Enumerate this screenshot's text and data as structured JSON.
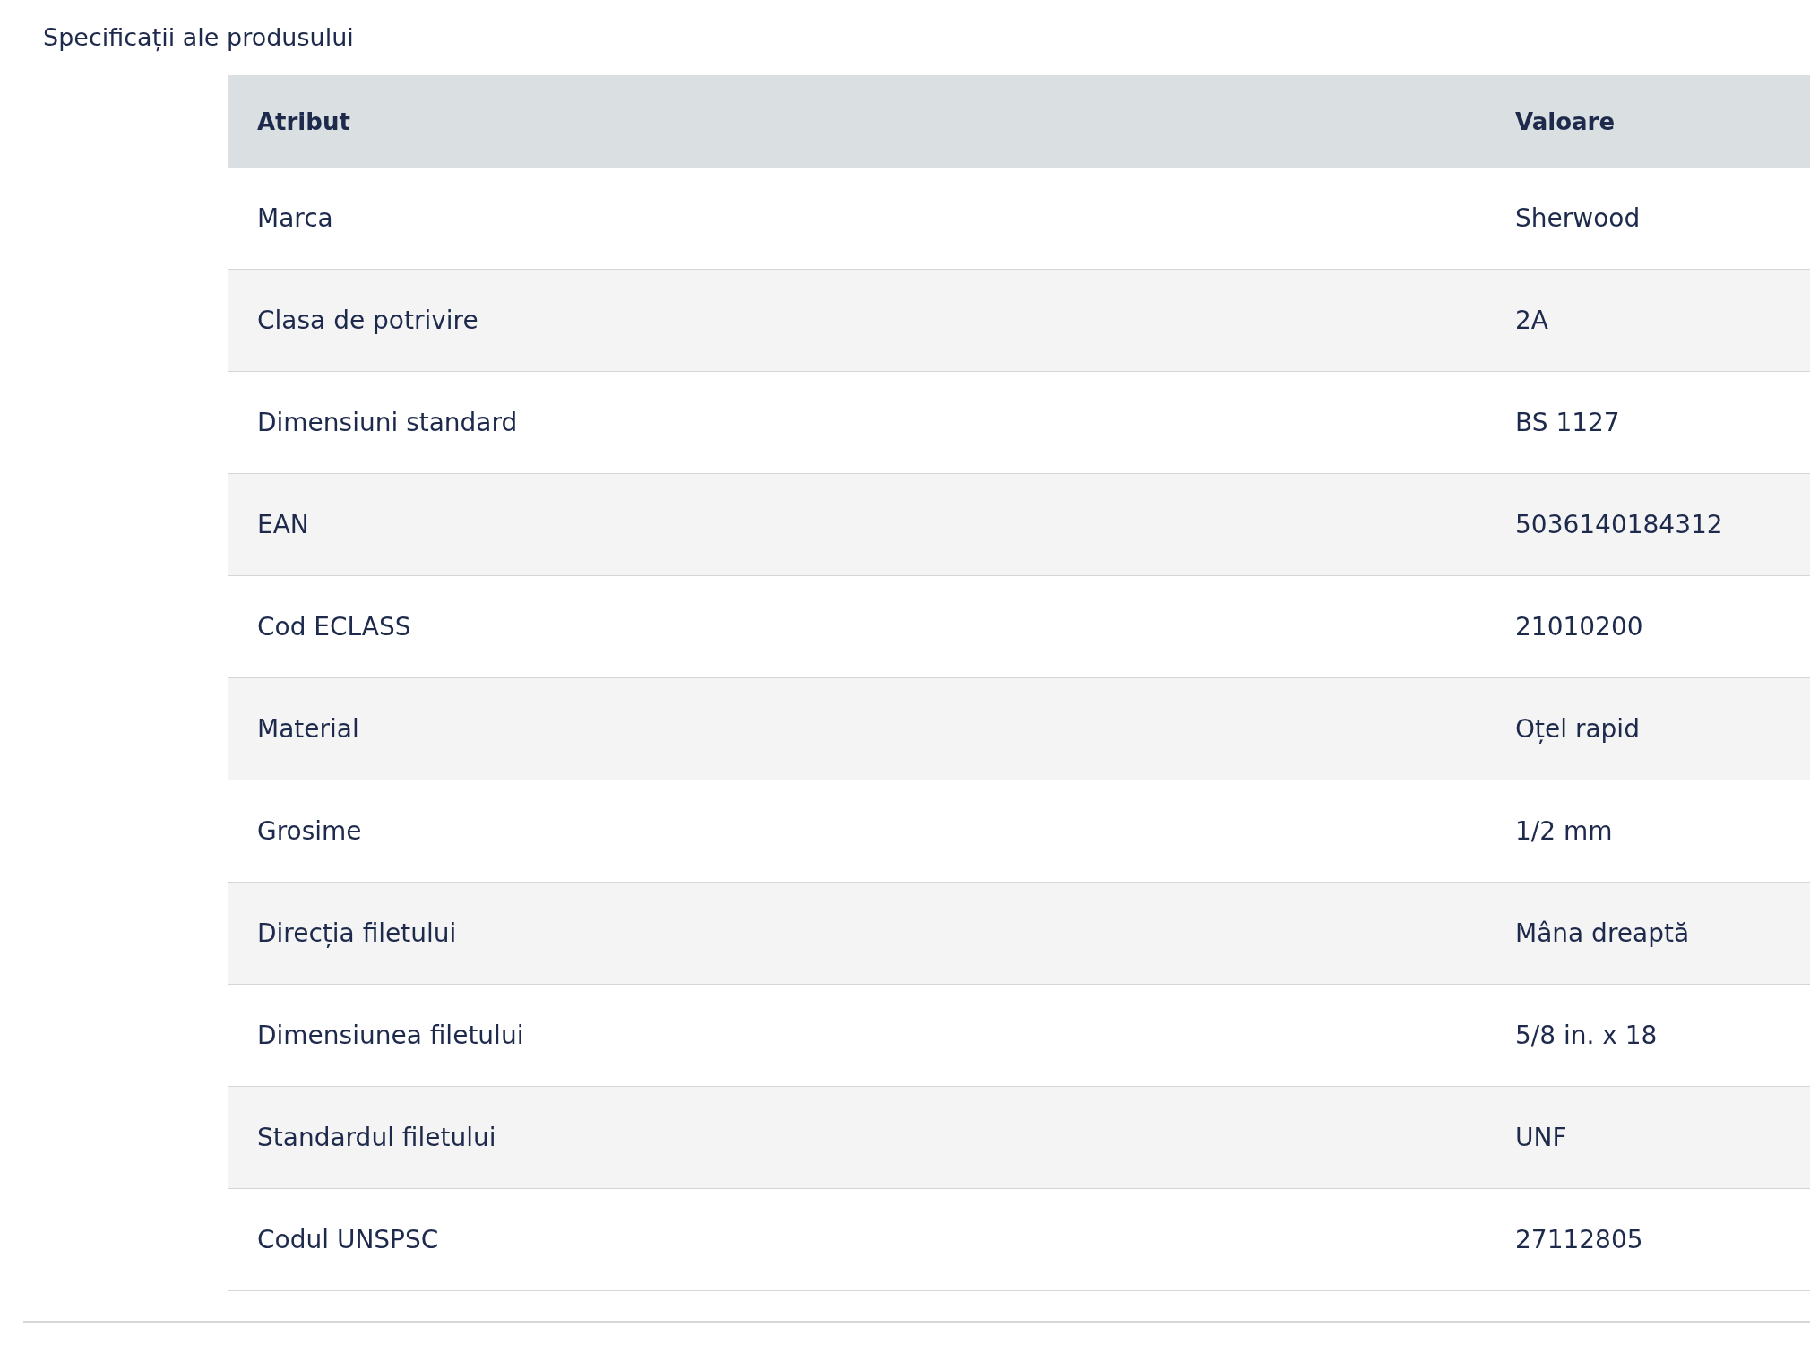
{
  "section_title": "Specificații ale produsului",
  "table": {
    "columns": [
      "Atribut",
      "Valoare"
    ],
    "rows": [
      {
        "attribute": "Marca",
        "value": "Sherwood"
      },
      {
        "attribute": "Clasa de potrivire",
        "value": "2A"
      },
      {
        "attribute": "Dimensiuni standard",
        "value": "BS 1127"
      },
      {
        "attribute": "EAN",
        "value": "5036140184312"
      },
      {
        "attribute": "Cod ECLASS",
        "value": "21010200"
      },
      {
        "attribute": "Material",
        "value": "Oțel rapid"
      },
      {
        "attribute": "Grosime",
        "value": "1/2 mm"
      },
      {
        "attribute": "Direcția filetului",
        "value": "Mâna dreaptă"
      },
      {
        "attribute": "Dimensiunea filetului",
        "value": "5/8 in. x 18"
      },
      {
        "attribute": "Standardul filetului",
        "value": "UNF"
      },
      {
        "attribute": "Codul UNSPSC",
        "value": "27112805"
      }
    ]
  }
}
